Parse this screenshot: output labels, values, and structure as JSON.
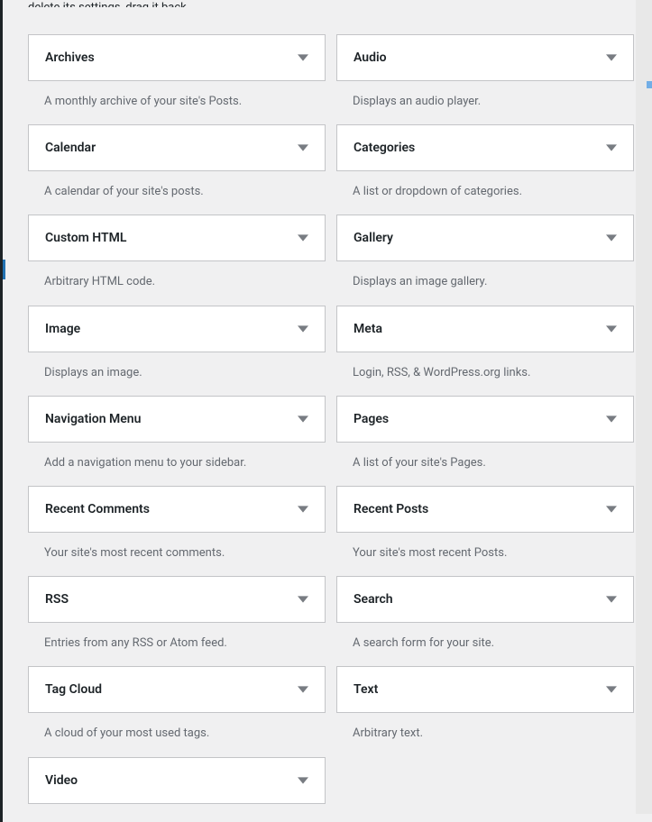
{
  "intro": "delete its settings, drag it back.",
  "left": [
    {
      "title": "Archives",
      "desc": "A monthly archive of your site's Posts."
    },
    {
      "title": "Calendar",
      "desc": "A calendar of your site's posts."
    },
    {
      "title": "Custom HTML",
      "desc": "Arbitrary HTML code."
    },
    {
      "title": "Image",
      "desc": "Displays an image."
    },
    {
      "title": "Navigation Menu",
      "desc": "Add a navigation menu to your sidebar."
    },
    {
      "title": "Recent Comments",
      "desc": "Your site's most recent comments."
    },
    {
      "title": "RSS",
      "desc": "Entries from any RSS or Atom feed."
    },
    {
      "title": "Tag Cloud",
      "desc": "A cloud of your most used tags."
    },
    {
      "title": "Video",
      "desc": ""
    }
  ],
  "right": [
    {
      "title": "Audio",
      "desc": "Displays an audio player."
    },
    {
      "title": "Categories",
      "desc": "A list or dropdown of categories."
    },
    {
      "title": "Gallery",
      "desc": "Displays an image gallery."
    },
    {
      "title": "Meta",
      "desc": "Login, RSS, & WordPress.org links."
    },
    {
      "title": "Pages",
      "desc": "A list of your site's Pages."
    },
    {
      "title": "Recent Posts",
      "desc": "Your site's most recent Posts."
    },
    {
      "title": "Search",
      "desc": "A search form for your site."
    },
    {
      "title": "Text",
      "desc": "Arbitrary text."
    }
  ]
}
